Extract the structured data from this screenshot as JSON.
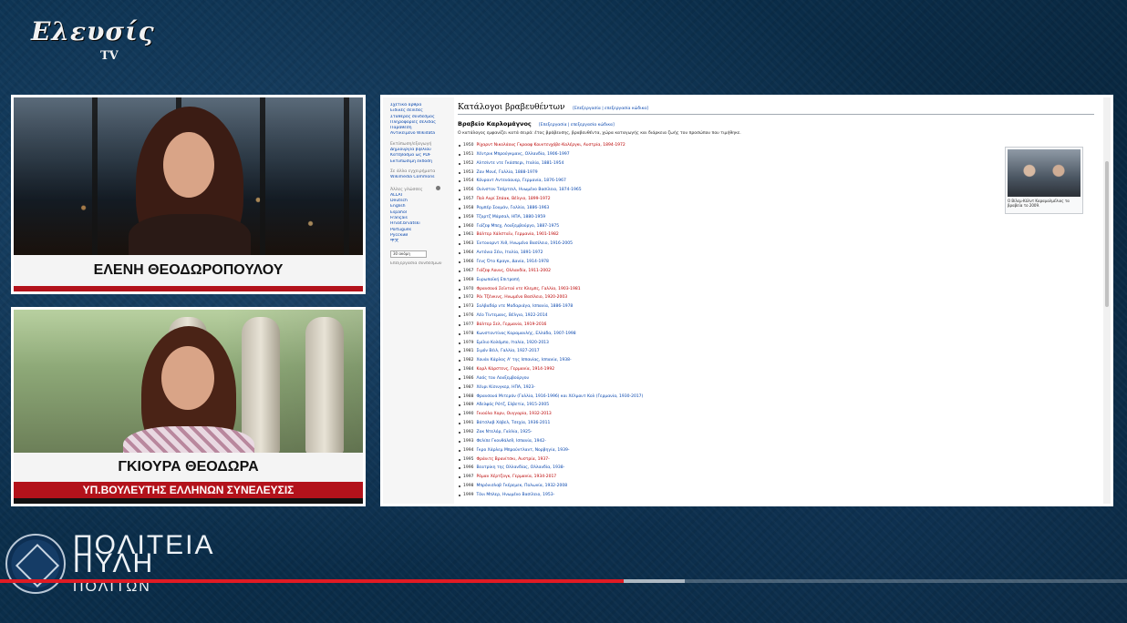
{
  "channel": {
    "logo_text": "Ελευσίς",
    "logo_tv": "TV"
  },
  "panel1": {
    "name": "ΕΛΕΝΗ ΘΕΟΔΩΡΟΠΟΥΛΟΥ"
  },
  "panel2": {
    "name": "ΓΚΙΟΥΡΑ ΘΕΟΔΩΡΑ",
    "subtitle": "ΥΠ.ΒΟΥΛΕΥΤΗΣ ΕΛΛΗΝΩΝ ΣΥΝΕΛΕΥΣΙΣ"
  },
  "wiki": {
    "title": "Κατάλογοι βραβευθέντων",
    "title_edit": "[Επεξεργασία | επεξεργασία κώδικα]",
    "section": "Βραβείο Καρλομάγνος",
    "section_edit": "[Επεξεργασία | επεξεργασία κώδικα]",
    "intro": "Ο κατάλογος εμφανίζει κατά σειρά: έτος βράβευσης, βραβευθέντα, χώρα καταγωγής και διάρκεια ζωής του προσώπου που τιμήθηκε.",
    "sidebar": {
      "nav": [
        "Σχετικά άρθρα",
        "Ειδικές σελίδες",
        "Σταθερός σύνδεσμος",
        "Πληροφορίες σελίδας",
        "Παράθεση",
        "Αντικείμενο Wikidata"
      ],
      "print_heading": "Εκτύπωση/εξαγωγή",
      "print": [
        "Δημιουργία βιβλίου",
        "Κατέβασμα ως PDF",
        "Εκτυπώσιμη έκδοση"
      ],
      "projects_heading": "Σε άλλα εγχειρήματα",
      "projects": [
        "Wikimedia Commons"
      ],
      "lang_heading": "Άλλες γλώσσες",
      "languages": [
        "ALLAT",
        "Deutsch",
        "English",
        "Español",
        "Français",
        "Hrvat.brvatski",
        "Português",
        "Pусский",
        "中文"
      ],
      "search_label": "30 ακόμη",
      "edit_links": "Επεξεργασία συνδέσμων"
    },
    "thumb_caption": "Ο Βίλεμ-Κόλντ Καραμαλμέλιος τα βραβεία το 2009.",
    "entries": [
      {
        "year": "1950",
        "text": "Ρίχαρντ Νικολάους Γκρααφ Κουντενχόβε-Καλέργκι, Αυστρία, 1894-1972",
        "red": true
      },
      {
        "year": "1951",
        "text": "Χέντρικ Μπρούγκμανς, Ολλανδία, 1906-1997",
        "red": false
      },
      {
        "year": "1952",
        "text": "Αλτσίντε ντε Γκάσπερι, Ιταλία, 1881-1954",
        "red": false
      },
      {
        "year": "1953",
        "text": "Ζαν Μονέ, Γαλλία, 1888-1979",
        "red": false
      },
      {
        "year": "1954",
        "text": "Κόνραντ Αντενάουερ, Γερμανία, 1876-1967",
        "red": false
      },
      {
        "year": "1956",
        "text": "Ουίνστον Τσόρτσιλ, Ηνωμένο Βασίλειο, 1874-1965",
        "red": false
      },
      {
        "year": "1957",
        "text": "Πολ Ανρί Σπάακ, Βέλγιο, 1899-1972",
        "red": true
      },
      {
        "year": "1958",
        "text": "Ρομπέρ Σουμάν, Γαλλία, 1886-1963",
        "red": false
      },
      {
        "year": "1959",
        "text": "Τζορτζ Μάρσαλ, ΗΠΑ, 1880-1959",
        "red": false
      },
      {
        "year": "1960",
        "text": "Γιόζεφ Μπεχ, Λουξεμβούργο, 1887-1975",
        "red": false
      },
      {
        "year": "1961",
        "text": "Βάλτερ Χάλσταϊν, Γερμανία, 1901-1982",
        "red": true
      },
      {
        "year": "1963",
        "text": "Έντουαρντ Χιθ, Ηνωμένο Βασίλειο, 1916-2005",
        "red": false
      },
      {
        "year": "1964",
        "text": "Αντόνιο Σένι, Ιταλία, 1891-1972",
        "red": false
      },
      {
        "year": "1966",
        "text": "Γενς Ότο Κραγκ, Δανία, 1914-1978",
        "red": false
      },
      {
        "year": "1967",
        "text": "Γιόζεφ Λουνς, Ολλανδία, 1911-2002",
        "red": true
      },
      {
        "year": "1969",
        "text": "Ευρωπαϊκή Επιτροπή",
        "red": false
      },
      {
        "year": "1970",
        "text": "Φρανσουά Σεϊντού ντε Κλεμπς, Γαλλία, 1903-1981",
        "red": true
      },
      {
        "year": "1972",
        "text": "Ρόι Τζένκινς, Ηνωμένο Βασίλειο, 1920-2003",
        "red": true
      },
      {
        "year": "1973",
        "text": "Σαλβαδόρ ντε Μαδαριάγα, Ισπανία, 1886-1978",
        "red": false
      },
      {
        "year": "1976",
        "text": "Λέο Τίντεμανς, Βέλγιο, 1922-2014",
        "red": false
      },
      {
        "year": "1977",
        "text": "Βάλτερ Σελ, Γερμανία, 1919-2016",
        "red": true
      },
      {
        "year": "1978",
        "text": "Κωνσταντίνος Καραμανλής, Ελλάδα, 1907-1998",
        "red": false
      },
      {
        "year": "1979",
        "text": "Εμίλιο Κολόμπο, Ιταλία, 1920-2013",
        "red": false
      },
      {
        "year": "1981",
        "text": "Σιμόν Βέιλ, Γαλλία, 1927-2017",
        "red": false
      },
      {
        "year": "1982",
        "text": "Χουάν Κάρλος Α' της Ισπανίας, Ισπανία, 1938-",
        "red": false
      },
      {
        "year": "1984",
        "text": "Καρλ Κάρστενς, Γερμανία, 1914-1992",
        "red": true
      },
      {
        "year": "1986",
        "text": "Λαός του Λουξεμβούργου",
        "red": false
      },
      {
        "year": "1987",
        "text": "Χένρι Κίσινγκερ, ΗΠΑ, 1923-",
        "red": false
      },
      {
        "year": "1988",
        "text": "Φρανσουά Μιτεράν (Γαλλία, 1916-1996) και Χέλμουτ Κολ (Γερμανία, 1930-2017)",
        "red": false
      },
      {
        "year": "1989",
        "text": "Αδελφός Ρότζ, Ελβετία, 1915-2005",
        "red": false
      },
      {
        "year": "1990",
        "text": "Γκιούλα Χορν, Ουγγαρία, 1932-2013",
        "red": true
      },
      {
        "year": "1991",
        "text": "Βάτσλαβ Χάβελ, Τσεχία, 1936-2011",
        "red": false
      },
      {
        "year": "1992",
        "text": "Ζακ Ντελόρ, Γαλλία, 1925-",
        "red": false
      },
      {
        "year": "1993",
        "text": "Φελίπε Γκονθάλεθ, Ισπανία, 1942-",
        "red": false
      },
      {
        "year": "1994",
        "text": "Γκρο Χάρλεμ Μπρούντλαντ, Νορβηγία, 1939-",
        "red": false
      },
      {
        "year": "1995",
        "text": "Φράνιτς Βρανίτσκι, Αυστρία, 1937-",
        "red": true
      },
      {
        "year": "1996",
        "text": "Βεατρίκη της Ολλανδίας, Ολλανδία, 1938-",
        "red": false
      },
      {
        "year": "1997",
        "text": "Ρόμαν Χέρτζογκ, Γερμανία, 1934-2017",
        "red": true
      },
      {
        "year": "1998",
        "text": "Μπρόνισλαβ Γκέρεμεκ, Πολωνία, 1932-2008",
        "red": false
      },
      {
        "year": "1999",
        "text": "Τόνι Μπλερ, Ηνωμένο Βασίλειο, 1953-",
        "red": false
      }
    ]
  },
  "brand": {
    "line1": "ΠΟΛΙΤΕΙΑ",
    "line2": "ΠΥΛΗ",
    "line3": "ΠΟΛΙΤΩΝ"
  },
  "video": {
    "progress": 0.553,
    "buffered": 0.608
  }
}
